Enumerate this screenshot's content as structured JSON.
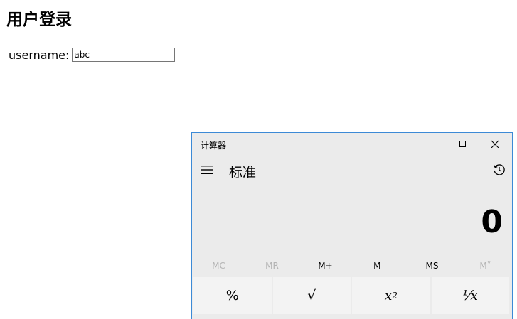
{
  "page": {
    "title": "用户登录",
    "username_label": "username:",
    "username_value": "abc"
  },
  "calculator": {
    "window_title": "计算器",
    "window_controls": {
      "minimize_icon": "minimize-icon",
      "maximize_icon": "maximize-icon",
      "close_icon": "close-icon"
    },
    "menu_icon": "hamburger-menu-icon",
    "mode": "标准",
    "history_icon": "history-icon",
    "display": "0",
    "memory": [
      {
        "label": "MC",
        "enabled": false
      },
      {
        "label": "MR",
        "enabled": false
      },
      {
        "label": "M+",
        "enabled": true
      },
      {
        "label": "M-",
        "enabled": true
      },
      {
        "label": "MS",
        "enabled": true
      },
      {
        "label": "M˅",
        "enabled": false
      }
    ],
    "keys": [
      {
        "label": "%"
      },
      {
        "label": "√"
      },
      {
        "label": "x",
        "sup": "2"
      },
      {
        "label": "¹⁄x"
      }
    ]
  },
  "colors": {
    "window_border": "#3c8ad6",
    "calc_background": "#ebebeb",
    "key_background": "#f3f3f3",
    "disabled_text": "#b3b3b3"
  }
}
